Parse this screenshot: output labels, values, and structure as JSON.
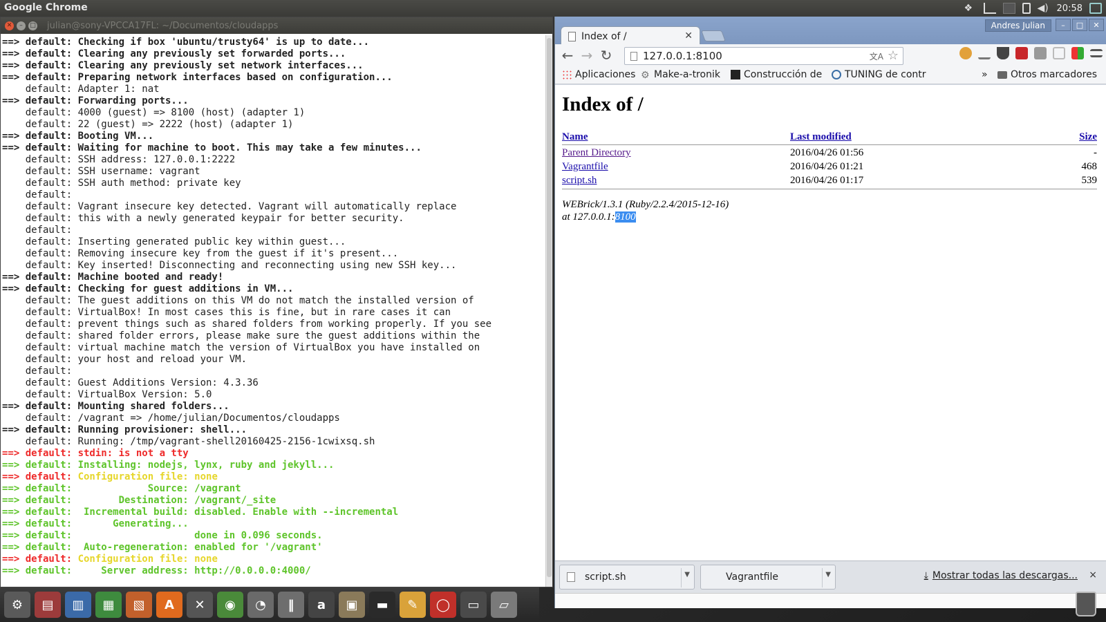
{
  "topbar": {
    "app_name": "Google Chrome",
    "clock": "20:58",
    "tray_icons": [
      "dropbox-icon",
      "network-icon",
      "keyboard-icon",
      "battery-icon",
      "volume-icon",
      "user-icon"
    ]
  },
  "terminal": {
    "title": "julian@sony-VPCCA17FL: ~/Documentos/cloudapps",
    "lines": [
      {
        "t": "==> default: Checking if box 'ubuntu/trusty64' is up to date...",
        "s": "b"
      },
      {
        "t": "==> default: Clearing any previously set forwarded ports...",
        "s": "b"
      },
      {
        "t": "==> default: Clearing any previously set network interfaces...",
        "s": "b"
      },
      {
        "t": "==> default: Preparing network interfaces based on configuration...",
        "s": "b"
      },
      {
        "t": "    default: Adapter 1: nat",
        "s": ""
      },
      {
        "t": "==> default: Forwarding ports...",
        "s": "b"
      },
      {
        "t": "    default: 4000 (guest) => 8100 (host) (adapter 1)",
        "s": ""
      },
      {
        "t": "    default: 22 (guest) => 2222 (host) (adapter 1)",
        "s": ""
      },
      {
        "t": "==> default: Booting VM...",
        "s": "b"
      },
      {
        "t": "==> default: Waiting for machine to boot. This may take a few minutes...",
        "s": "b"
      },
      {
        "t": "    default: SSH address: 127.0.0.1:2222",
        "s": ""
      },
      {
        "t": "    default: SSH username: vagrant",
        "s": ""
      },
      {
        "t": "    default: SSH auth method: private key",
        "s": ""
      },
      {
        "t": "    default:",
        "s": ""
      },
      {
        "t": "    default: Vagrant insecure key detected. Vagrant will automatically replace",
        "s": ""
      },
      {
        "t": "    default: this with a newly generated keypair for better security.",
        "s": ""
      },
      {
        "t": "    default:",
        "s": ""
      },
      {
        "t": "    default: Inserting generated public key within guest...",
        "s": ""
      },
      {
        "t": "    default: Removing insecure key from the guest if it's present...",
        "s": ""
      },
      {
        "t": "    default: Key inserted! Disconnecting and reconnecting using new SSH key...",
        "s": ""
      },
      {
        "t": "==> default: Machine booted and ready!",
        "s": "b"
      },
      {
        "t": "==> default: Checking for guest additions in VM...",
        "s": "b"
      },
      {
        "t": "    default: The guest additions on this VM do not match the installed version of",
        "s": ""
      },
      {
        "t": "    default: VirtualBox! In most cases this is fine, but in rare cases it can",
        "s": ""
      },
      {
        "t": "    default: prevent things such as shared folders from working properly. If you see",
        "s": ""
      },
      {
        "t": "    default: shared folder errors, please make sure the guest additions within the",
        "s": ""
      },
      {
        "t": "    default: virtual machine match the version of VirtualBox you have installed on",
        "s": ""
      },
      {
        "t": "    default: your host and reload your VM.",
        "s": ""
      },
      {
        "t": "    default:",
        "s": ""
      },
      {
        "t": "    default: Guest Additions Version: 4.3.36",
        "s": ""
      },
      {
        "t": "    default: VirtualBox Version: 5.0",
        "s": ""
      },
      {
        "t": "==> default: Mounting shared folders...",
        "s": "b"
      },
      {
        "t": "    default: /vagrant => /home/julian/Documentos/cloudapps",
        "s": ""
      },
      {
        "t": "==> default: Running provisioner: shell...",
        "s": "b"
      },
      {
        "t": "    default: Running: /tmp/vagrant-shell20160425-2156-1cwixsq.sh",
        "s": ""
      },
      {
        "t": "==> default: stdin: is not a tty",
        "s": "red"
      },
      {
        "t": "==> default: Installing: nodejs, lynx, ruby and jekyll...",
        "s": "grn"
      },
      {
        "t": "==> default: Configuration file: none",
        "s": "red-yel",
        "a": "==> default: ",
        "b": "Configuration file: none"
      },
      {
        "t": "==> default:             Source: /vagrant",
        "s": "grn"
      },
      {
        "t": "==> default:        Destination: /vagrant/_site",
        "s": "grn"
      },
      {
        "t": "==> default:  Incremental build: disabled. Enable with --incremental",
        "s": "grn"
      },
      {
        "t": "==> default:       Generating...",
        "s": "grn"
      },
      {
        "t": "==> default:                     done in 0.096 seconds.",
        "s": "grn"
      },
      {
        "t": "==> default:  Auto-regeneration: enabled for '/vagrant'",
        "s": "grn"
      },
      {
        "t": "==> default: Configuration file: none",
        "s": "red-yel",
        "a": "==> default: ",
        "b": "Configuration file: none"
      },
      {
        "t": "==> default:     Server address: http://0.0.0.0:4000/",
        "s": "grn"
      }
    ]
  },
  "chrome": {
    "tab_title": "Index of /",
    "profile_name": "Andres Julian",
    "address": "127.0.0.1:8100",
    "bookmarks": [
      "Aplicaciones",
      "Make-a-tronik",
      "Construcción de",
      "TUNING de contr",
      "Otros marcadores"
    ],
    "bookmarks_overflow": "»",
    "page": {
      "heading": "Index of /",
      "columns": {
        "name": "Name",
        "modified": "Last modified",
        "size": "Size"
      },
      "rows": [
        {
          "name": "Parent Directory",
          "modified": "2016/04/26 01:56",
          "size": "-"
        },
        {
          "name": "Vagrantfile",
          "modified": "2016/04/26 01:21",
          "size": "468"
        },
        {
          "name": "script.sh",
          "modified": "2016/04/26 01:17",
          "size": "539"
        }
      ],
      "footer_line1": "WEBrick/1.3.1 (Ruby/2.2.4/2015-12-16)",
      "footer_line2_prefix": "at 127.0.0.1:",
      "footer_line2_selected": "8100"
    },
    "downloads": {
      "items": [
        "script.sh",
        "Vagrantfile"
      ],
      "show_all": "Mostrar todas las descargas...",
      "close": "×"
    }
  },
  "dock": {
    "apps": [
      {
        "icon": "system-settings-icon",
        "color": "#5a5a5a",
        "glyph": "⚙"
      },
      {
        "icon": "files-icon",
        "color": "#9c3b3b",
        "glyph": "▤"
      },
      {
        "icon": "writer-icon",
        "color": "#3b6aa8",
        "glyph": "▥"
      },
      {
        "icon": "calc-icon",
        "color": "#3e8b3e",
        "glyph": "▦"
      },
      {
        "icon": "impress-icon",
        "color": "#c2602b",
        "glyph": "▧"
      },
      {
        "icon": "software-center-icon",
        "color": "#e06a1e",
        "glyph": "A"
      },
      {
        "icon": "tools-icon",
        "color": "#555555",
        "glyph": "✕"
      },
      {
        "icon": "chrome-icon",
        "color": "#4a8a3a",
        "glyph": "◉"
      },
      {
        "icon": "system-monitor-icon",
        "color": "#6a6a6a",
        "glyph": "◔"
      },
      {
        "icon": "equalizer-icon",
        "color": "#6e6e6e",
        "glyph": "‖"
      },
      {
        "icon": "amazon-icon",
        "color": "#444444",
        "glyph": "a"
      },
      {
        "icon": "archive-icon",
        "color": "#8a7a5a",
        "glyph": "▣"
      },
      {
        "icon": "terminal-icon",
        "color": "#2a2a2a",
        "glyph": "▬"
      },
      {
        "icon": "text-editor-icon",
        "color": "#d9a23a",
        "glyph": "✎"
      },
      {
        "icon": "pdf-viewer-icon",
        "color": "#c0302a",
        "glyph": "◯"
      },
      {
        "icon": "workspaces-icon",
        "color": "#4a4a4a",
        "glyph": "▭"
      },
      {
        "icon": "drive-icon",
        "color": "#7a7a7a",
        "glyph": "▱"
      }
    ]
  }
}
